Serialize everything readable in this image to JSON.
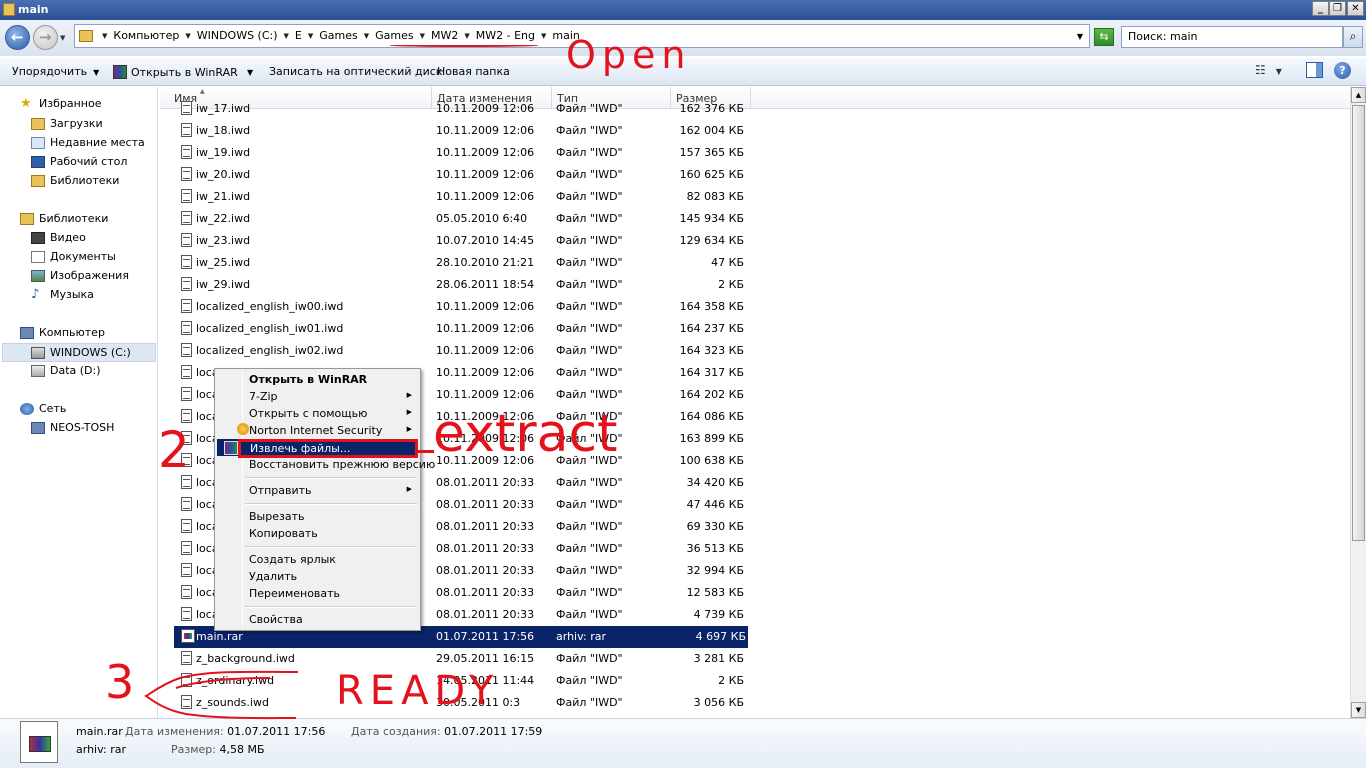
{
  "window": {
    "title": "main"
  },
  "address": {
    "crumbs": [
      "Компьютер",
      "WINDOWS (C:)",
      "E",
      "Games",
      "Games",
      "MW2",
      "MW2 - Eng",
      "main"
    ],
    "search_placeholder": "Поиск: main"
  },
  "toolbar": {
    "organize": "Упорядочить",
    "open_winrar": "Открыть в WinRAR",
    "burn": "Записать на оптический диск",
    "new_folder": "Новая папка"
  },
  "nav": {
    "favorites": "Избранное",
    "downloads": "Загрузки",
    "recent": "Недавние места",
    "desktop": "Рабочий стол",
    "libraries_fav": "Библиотеки",
    "libraries": "Библиотеки",
    "video": "Видео",
    "documents": "Документы",
    "images": "Изображения",
    "music": "Музыка",
    "computer": "Компьютер",
    "drive_c": "WINDOWS (C:)",
    "drive_d": "Data (D:)",
    "network": "Сеть",
    "neos": "NEOS-TOSH"
  },
  "columns": {
    "name": "Имя",
    "date": "Дата изменения",
    "type": "Тип",
    "size": "Размер"
  },
  "files": [
    {
      "name": "iw_17.iwd",
      "date": "10.11.2009 12:06",
      "type": "Файл \"IWD\"",
      "size": "162 376 КБ"
    },
    {
      "name": "iw_18.iwd",
      "date": "10.11.2009 12:06",
      "type": "Файл \"IWD\"",
      "size": "162 004 КБ"
    },
    {
      "name": "iw_19.iwd",
      "date": "10.11.2009 12:06",
      "type": "Файл \"IWD\"",
      "size": "157 365 КБ"
    },
    {
      "name": "iw_20.iwd",
      "date": "10.11.2009 12:06",
      "type": "Файл \"IWD\"",
      "size": "160 625 КБ"
    },
    {
      "name": "iw_21.iwd",
      "date": "10.11.2009 12:06",
      "type": "Файл \"IWD\"",
      "size": "82 083 КБ"
    },
    {
      "name": "iw_22.iwd",
      "date": "05.05.2010 6:40",
      "type": "Файл \"IWD\"",
      "size": "145 934 КБ"
    },
    {
      "name": "iw_23.iwd",
      "date": "10.07.2010 14:45",
      "type": "Файл \"IWD\"",
      "size": "129 634 КБ"
    },
    {
      "name": "iw_25.iwd",
      "date": "28.10.2010 21:21",
      "type": "Файл \"IWD\"",
      "size": "47 КБ"
    },
    {
      "name": "iw_29.iwd",
      "date": "28.06.2011 18:54",
      "type": "Файл \"IWD\"",
      "size": "2 КБ"
    },
    {
      "name": "localized_english_iw00.iwd",
      "date": "10.11.2009 12:06",
      "type": "Файл \"IWD\"",
      "size": "164 358 КБ"
    },
    {
      "name": "localized_english_iw01.iwd",
      "date": "10.11.2009 12:06",
      "type": "Файл \"IWD\"",
      "size": "164 237 КБ"
    },
    {
      "name": "localized_english_iw02.iwd",
      "date": "10.11.2009 12:06",
      "type": "Файл \"IWD\"",
      "size": "164 323 КБ"
    },
    {
      "name": "loca",
      "date": "10.11.2009 12:06",
      "type": "Файл \"IWD\"",
      "size": "164 317 КБ"
    },
    {
      "name": "loca",
      "date": "10.11.2009 12:06",
      "type": "Файл \"IWD\"",
      "size": "164 202 КБ"
    },
    {
      "name": "loca",
      "date": "10.11.2009 12:06",
      "type": "Файл \"IWD\"",
      "size": "164 086 КБ"
    },
    {
      "name": "loca",
      "date": "10.11.2009 12:06",
      "type": "Файл \"IWD\"",
      "size": "163 899 КБ"
    },
    {
      "name": "loca",
      "date": "10.11.2009 12:06",
      "type": "Файл \"IWD\"",
      "size": "100 638 КБ"
    },
    {
      "name": "loca",
      "date": "08.01.2011 20:33",
      "type": "Файл \"IWD\"",
      "size": "34 420 КБ"
    },
    {
      "name": "loca",
      "date": "08.01.2011 20:33",
      "type": "Файл \"IWD\"",
      "size": "47 446 КБ"
    },
    {
      "name": "loca",
      "date": "08.01.2011 20:33",
      "type": "Файл \"IWD\"",
      "size": "69 330 КБ"
    },
    {
      "name": "loca",
      "date": "08.01.2011 20:33",
      "type": "Файл \"IWD\"",
      "size": "36 513 КБ"
    },
    {
      "name": "loca",
      "date": "08.01.2011 20:33",
      "type": "Файл \"IWD\"",
      "size": "32 994 КБ"
    },
    {
      "name": "loca",
      "date": "08.01.2011 20:33",
      "type": "Файл \"IWD\"",
      "size": "12 583 КБ"
    },
    {
      "name": "loca",
      "date": "08.01.2011 20:33",
      "type": "Файл \"IWD\"",
      "size": "4 739 КБ"
    },
    {
      "name": "main.rar",
      "date": "01.07.2011 17:56",
      "type": "arhiv: rar",
      "size": "4 697 КБ",
      "selected": true
    },
    {
      "name": "z_background.iwd",
      "date": "29.05.2011 16:15",
      "type": "Файл \"IWD\"",
      "size": "3 281 КБ"
    },
    {
      "name": "z_ordinary.iwd",
      "date": "14.05.2011 11:44",
      "type": "Файл \"IWD\"",
      "size": "2 КБ"
    },
    {
      "name": "z_sounds.iwd",
      "date": "30.05.2011 0:3",
      "type": "Файл \"IWD\"",
      "size": "3 056 КБ"
    }
  ],
  "context_menu": {
    "open_winrar": "Открыть в WinRAR",
    "seven_zip": "7-Zip",
    "open_with": "Открыть с помощью",
    "norton": "Norton Internet Security",
    "extract": "Извлечь файлы...",
    "restore": "Восстановить прежнюю версию",
    "send_to": "Отправить",
    "cut": "Вырезать",
    "copy": "Копировать",
    "shortcut": "Создать ярлык",
    "delete": "Удалить",
    "rename": "Переименовать",
    "properties": "Свойства"
  },
  "details": {
    "name": "main.rar",
    "type": "arhiv: rar",
    "modified_label": "Дата изменения:",
    "modified": "01.07.2011 17:56",
    "created_label": "Дата создания:",
    "created": "01.07.2011 17:59",
    "size_label": "Размер:",
    "size": "4,58 МБ"
  },
  "annotations": {
    "open": "Open",
    "extract": "extract",
    "ready": "READY",
    "step2": "2",
    "step3": "3",
    "color": "#e3131d"
  }
}
